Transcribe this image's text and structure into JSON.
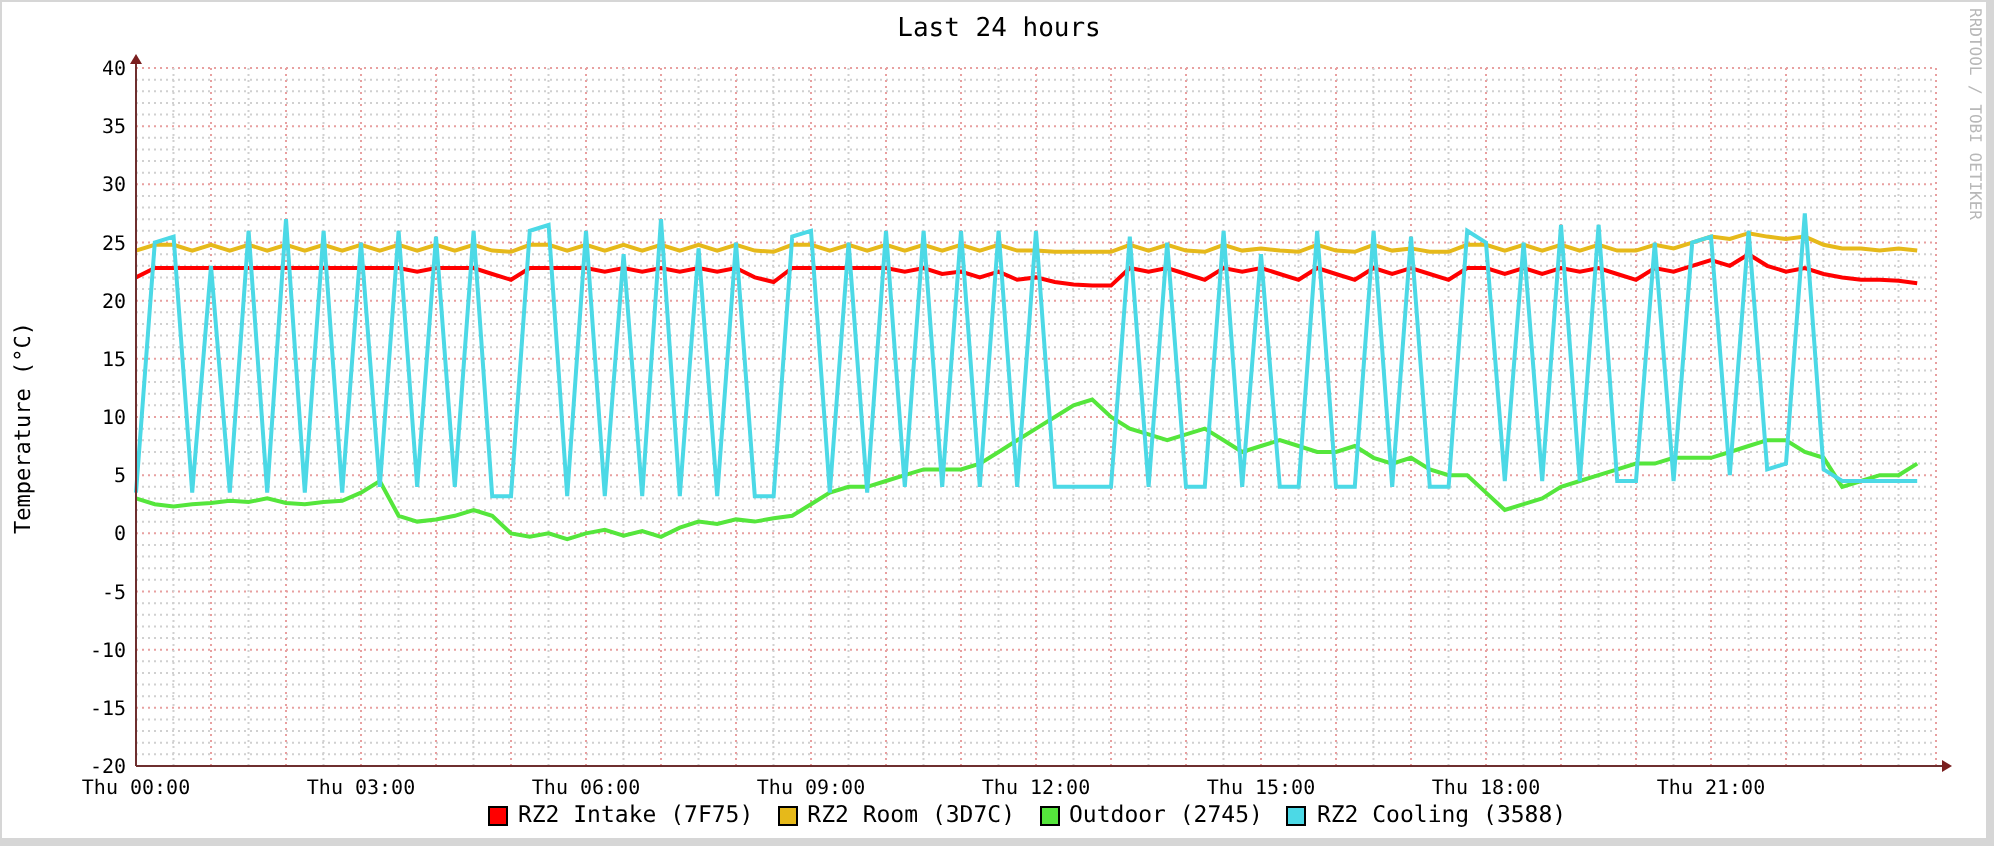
{
  "graph": {
    "credit": "RRDTOOL / TOBI OETIKER",
    "chart_data": {
      "type": "line",
      "title": "Last 24 hours",
      "ylabel": "Temperature (°C)",
      "categories": [
        "Thu 00:00",
        null,
        null,
        null,
        null,
        null,
        null,
        null,
        null,
        null,
        null,
        null,
        "Thu 03:00",
        null,
        null,
        null,
        null,
        null,
        null,
        null,
        null,
        null,
        null,
        null,
        "Thu 06:00",
        null,
        null,
        null,
        null,
        null,
        null,
        null,
        null,
        null,
        null,
        null,
        "Thu 09:00",
        null,
        null,
        null,
        null,
        null,
        null,
        null,
        null,
        null,
        null,
        null,
        "Thu 12:00",
        null,
        null,
        null,
        null,
        null,
        null,
        null,
        null,
        null,
        null,
        null,
        "Thu 15:00",
        null,
        null,
        null,
        null,
        null,
        null,
        null,
        null,
        null,
        null,
        null,
        "Thu 18:00",
        null,
        null,
        null,
        null,
        null,
        null,
        null,
        null,
        null,
        null,
        null,
        "Thu 21:00",
        null,
        null,
        null,
        null,
        null,
        null,
        null,
        null,
        null,
        null,
        null
      ],
      "ylim": [
        -20,
        40
      ],
      "grid": true,
      "yticks": [
        -20,
        -15,
        -10,
        -5,
        0,
        5,
        10,
        15,
        20,
        25,
        30,
        35,
        40
      ],
      "series": [
        {
          "name": "RZ2 Intake (7F75)",
          "color": "#ff0000",
          "values": [
            22,
            22.8,
            22.8,
            22.8,
            22.8,
            22.8,
            22.8,
            22.8,
            22.8,
            22.8,
            22.8,
            22.8,
            22.8,
            22.8,
            22.8,
            22.5,
            22.8,
            22.8,
            22.8,
            22.3,
            21.8,
            22.8,
            22.8,
            22.8,
            22.8,
            22.5,
            22.8,
            22.5,
            22.8,
            22.5,
            22.8,
            22.5,
            22.8,
            22,
            21.6,
            22.8,
            22.8,
            22.8,
            22.8,
            22.8,
            22.8,
            22.5,
            22.8,
            22.3,
            22.5,
            22,
            22.5,
            21.8,
            22,
            21.6,
            21.4,
            21.3,
            21.3,
            22.8,
            22.5,
            22.8,
            22.3,
            21.8,
            22.8,
            22.5,
            22.8,
            22.3,
            21.8,
            22.8,
            22.3,
            21.8,
            22.8,
            22.3,
            22.8,
            22.3,
            21.8,
            22.8,
            22.8,
            22.3,
            22.8,
            22.3,
            22.8,
            22.5,
            22.8,
            22.3,
            21.8,
            22.8,
            22.5,
            23,
            23.5,
            23,
            24,
            23,
            22.5,
            22.8,
            22.3,
            22,
            21.8,
            21.8,
            21.7,
            21.5
          ]
        },
        {
          "name": "RZ2 Room (3D7C)",
          "color": "#e6b91a",
          "values": [
            24.3,
            24.8,
            24.8,
            24.3,
            24.8,
            24.3,
            24.8,
            24.3,
            24.8,
            24.3,
            24.8,
            24.3,
            24.8,
            24.3,
            24.8,
            24.3,
            24.8,
            24.3,
            24.8,
            24.3,
            24.2,
            24.8,
            24.8,
            24.3,
            24.8,
            24.3,
            24.8,
            24.3,
            24.8,
            24.3,
            24.8,
            24.3,
            24.8,
            24.3,
            24.2,
            24.8,
            24.8,
            24.3,
            24.8,
            24.3,
            24.8,
            24.3,
            24.8,
            24.3,
            24.8,
            24.3,
            24.8,
            24.3,
            24.3,
            24.2,
            24.2,
            24.2,
            24.2,
            24.8,
            24.3,
            24.8,
            24.3,
            24.2,
            24.8,
            24.3,
            24.5,
            24.3,
            24.2,
            24.8,
            24.3,
            24.2,
            24.8,
            24.3,
            24.5,
            24.2,
            24.2,
            24.8,
            24.8,
            24.3,
            24.8,
            24.3,
            24.8,
            24.3,
            24.8,
            24.3,
            24.3,
            24.8,
            24.5,
            25,
            25.5,
            25.3,
            25.8,
            25.5,
            25.3,
            25.5,
            24.8,
            24.5,
            24.5,
            24.3,
            24.5,
            24.3
          ]
        },
        {
          "name": "Outdoor (2745)",
          "color": "#55e63c",
          "values": [
            3,
            2.5,
            2.3,
            2.5,
            2.6,
            2.8,
            2.7,
            3,
            2.6,
            2.5,
            2.7,
            2.8,
            3.5,
            4.5,
            1.5,
            1,
            1.2,
            1.5,
            2,
            1.5,
            0,
            -0.3,
            0,
            -0.5,
            0,
            0.3,
            -0.2,
            0.2,
            -0.3,
            0.5,
            1,
            0.8,
            1.2,
            1,
            1.3,
            1.5,
            2.5,
            3.5,
            4,
            4,
            4.5,
            5,
            5.5,
            5.5,
            5.5,
            6,
            7,
            8,
            9,
            10,
            11,
            11.5,
            10,
            9,
            8.5,
            8,
            8.5,
            9,
            8,
            7,
            7.5,
            8,
            7.5,
            7,
            7,
            7.5,
            6.5,
            6,
            6.5,
            5.5,
            5,
            5,
            3.5,
            2,
            2.5,
            3,
            4,
            4.5,
            5,
            5.5,
            6,
            6,
            6.5,
            6.5,
            6.5,
            7,
            7.5,
            8,
            8,
            7,
            6.5,
            4,
            4.5,
            5,
            5,
            6
          ]
        },
        {
          "name": "RZ2 Cooling (3588)",
          "color": "#4cd9e6",
          "values": [
            3.5,
            25,
            25.5,
            3.5,
            23,
            3.5,
            26,
            3.5,
            27,
            3.5,
            26,
            3.5,
            25,
            4,
            26,
            4,
            25.5,
            4,
            26,
            3.2,
            3.2,
            26,
            26.5,
            3.2,
            26,
            3.2,
            24,
            3.2,
            27,
            3.2,
            24.5,
            3.2,
            25,
            3.2,
            3.2,
            25.5,
            26,
            3.5,
            25,
            3.5,
            26,
            4,
            26,
            4,
            26,
            4,
            26,
            4,
            26,
            4,
            4,
            4,
            4,
            25.5,
            4,
            25,
            4,
            4,
            26,
            4,
            24,
            4,
            4,
            26,
            4,
            4,
            26,
            4,
            25.5,
            4,
            4,
            26,
            25,
            4.5,
            25,
            4.5,
            26.5,
            4.5,
            26.5,
            4.5,
            4.5,
            25,
            4.5,
            25,
            25.5,
            5,
            26,
            5.5,
            6,
            27.5,
            5.5,
            4.5,
            4.5,
            4.5,
            4.5,
            4.5
          ]
        }
      ]
    }
  }
}
